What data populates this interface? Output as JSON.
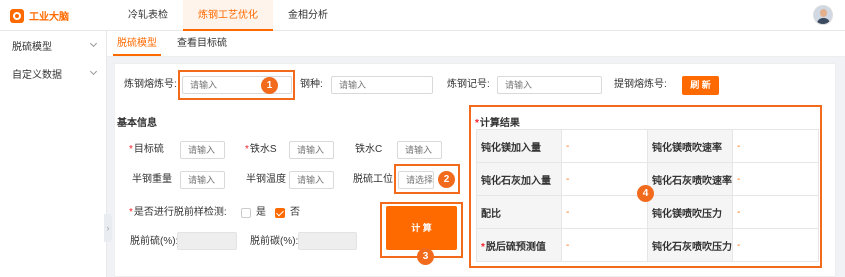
{
  "app": {
    "logo": "工业大脑"
  },
  "topnav": {
    "items": [
      "冷轧表检",
      "炼钢工艺优化",
      "金相分析"
    ],
    "active_index": 1
  },
  "sidebar": {
    "items": [
      {
        "label": "脱硫模型"
      },
      {
        "label": "自定义数据"
      }
    ]
  },
  "subtabs": {
    "items": [
      "脱硫模型",
      "查看目标硫"
    ],
    "active_index": 0
  },
  "search": {
    "heat_no_label": "炼钢熔炼号:",
    "heat_no_placeholder": "请输入",
    "steel_grade_label": "钢种:",
    "steel_grade_placeholder": "请输入",
    "steel_mark_label": "炼钢记号:",
    "steel_mark_placeholder": "请输入",
    "fetch_heat_label": "提钢熔炼号:",
    "refresh_button": "刷 新"
  },
  "basic": {
    "title": "基本信息",
    "target_s_label": "目标硫",
    "iron_s_label": "铁水S",
    "iron_c_label": "铁水C",
    "half_steel_weight_label": "半钢重量",
    "half_steel_temp_label": "半钢温度",
    "desulf_station_label": "脱硫工位",
    "placeholder": "请输入",
    "select_placeholder": "请选择",
    "pre_check_label": "是否进行脱前样检测:",
    "yes_label": "是",
    "no_label": "否",
    "pre_s_label": "脱前硫(%):",
    "pre_c_label": "脱前碳(%):",
    "calc_button": "计 算"
  },
  "results": {
    "title": "计算结果",
    "rows": [
      {
        "left_label": "钝化镁加入量",
        "left_value": "-",
        "right_label": "钝化镁喷吹速率",
        "right_value": "-"
      },
      {
        "left_label": "钝化石灰加入量",
        "left_value": "-",
        "right_label": "钝化石灰喷吹速率",
        "right_value": "-"
      },
      {
        "left_label": "配比",
        "left_value": "-",
        "right_label": "钝化镁喷吹压力",
        "right_value": "-"
      },
      {
        "left_label": "脱后硫预测值",
        "left_value": "-",
        "right_label": "钝化石灰喷吹压力",
        "right_value": "-"
      }
    ]
  },
  "callouts": [
    "1",
    "2",
    "3",
    "4"
  ],
  "colors": {
    "accent": "#ff6a00",
    "callout": "#f26b1d",
    "required": "#f5222d"
  }
}
